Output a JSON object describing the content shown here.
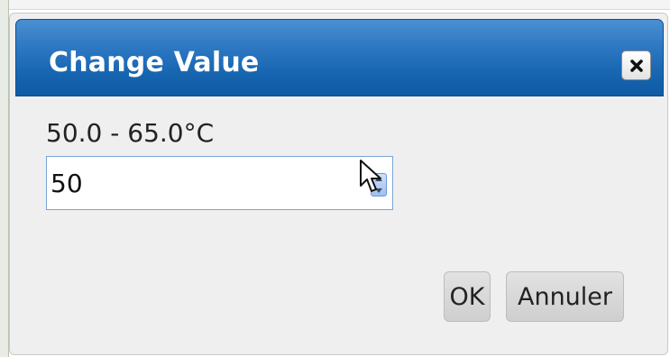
{
  "dialog": {
    "title": "Change Value",
    "close_icon": "close-icon",
    "range_label": "50.0 - 65.0°C",
    "input_value": "50",
    "ok_label": "OK",
    "cancel_label": "Annuler"
  },
  "colors": {
    "titlebar": "#1766b1",
    "title_text": "#ffffff",
    "dialog_bg": "#efefef",
    "input_border": "#7aa6d6",
    "button_bg": "#d8d8d8"
  }
}
